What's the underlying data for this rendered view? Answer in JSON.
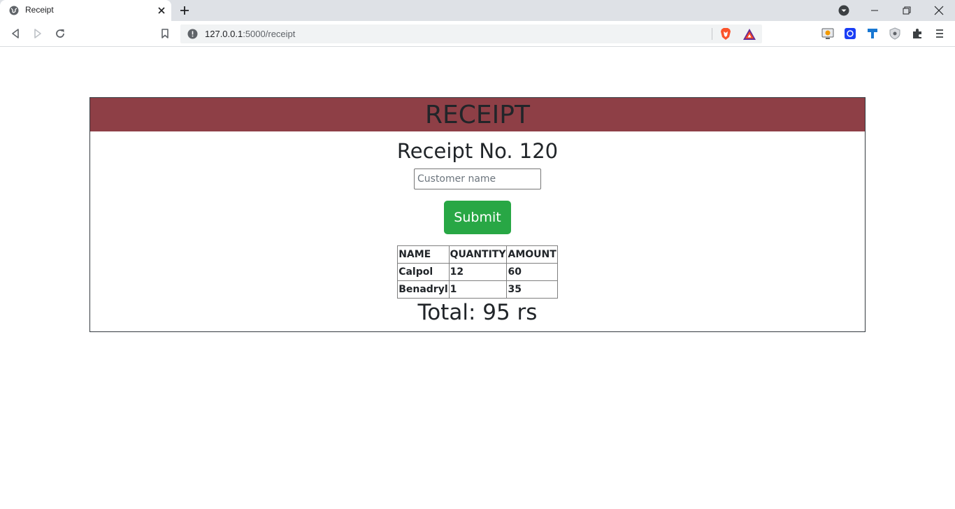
{
  "browser": {
    "tab_title": "Receipt",
    "url_host": "127.0.0.1",
    "url_rest": ":5000/receipt"
  },
  "receipt": {
    "header": "RECEIPT",
    "receipt_no": "Receipt No. 120",
    "customer_placeholder": "Customer name",
    "submit_label": "Submit",
    "table_headers": [
      "NAME",
      "QUANTITY",
      "AMOUNT"
    ],
    "rows": [
      {
        "name": "Calpol",
        "quantity": "12",
        "amount": "60"
      },
      {
        "name": "Benadryl",
        "quantity": "1",
        "amount": "35"
      }
    ],
    "total": "Total: 95 rs"
  },
  "colors": {
    "header_bg": "#8e3f46",
    "submit_bg": "#28a745"
  },
  "icons": [
    "globe-icon",
    "close-icon",
    "plus-icon",
    "tab-search-icon",
    "minimize-icon",
    "restore-icon",
    "back-icon",
    "forward-icon",
    "reload-icon",
    "bookmark-icon",
    "info-icon",
    "brave-shields-icon",
    "brave-rewards-icon",
    "puzzle-icon",
    "menu-icon"
  ]
}
